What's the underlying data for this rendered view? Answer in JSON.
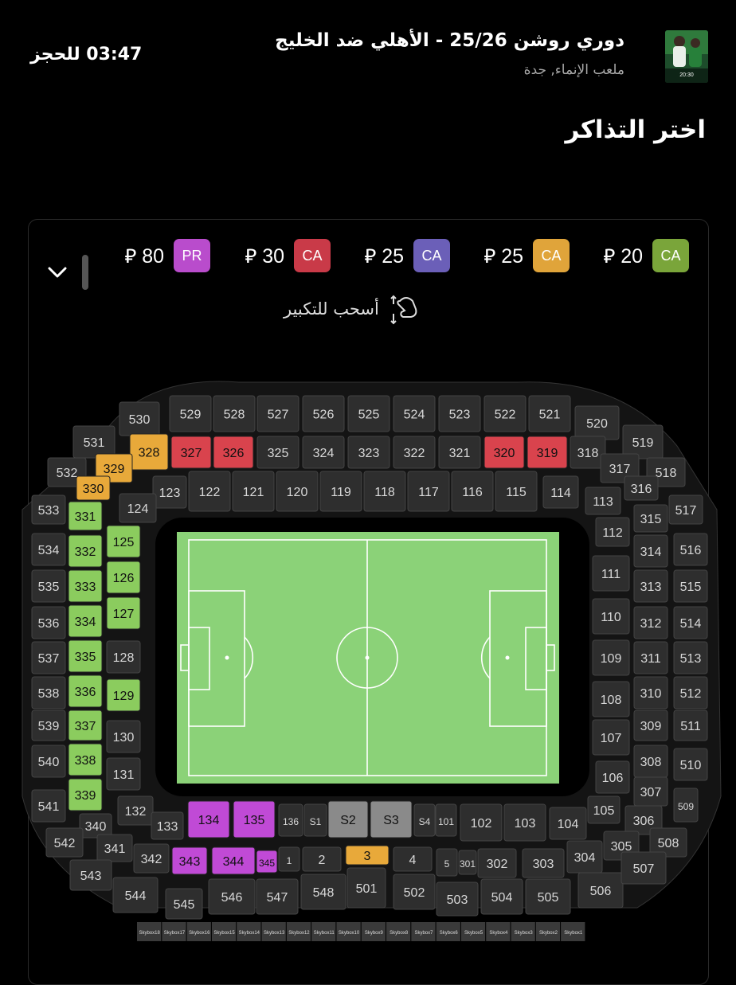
{
  "header": {
    "title": "دوري روشن 25/26 - الأهلي ضد الخليج",
    "venue": "ملعب الإنماء, جدة",
    "timer": "03:47 للحجز",
    "thumb_time": "20:30"
  },
  "page_title": "اختر التذاكر",
  "legend": [
    {
      "code": "CA",
      "price": "20 ⃁",
      "color": "#7aa53a"
    },
    {
      "code": "CA",
      "price": "25 ⃁",
      "color": "#e0a43a"
    },
    {
      "code": "CA",
      "price": "25 ⃁",
      "color": "#6b5fb8"
    },
    {
      "code": "CA",
      "price": "30 ⃁",
      "color": "#c93a48"
    },
    {
      "code": "PR",
      "price": "80 ⃁",
      "color": "#b94ccc"
    }
  ],
  "zoom_hint": "أسحب للتكبير",
  "colors": {
    "green": "#8bcc5e",
    "orange": "#e8a93a",
    "red": "#d9434d",
    "purple": "#c04ad6",
    "gray": "#2e2e2e",
    "pitch": "#8bd278"
  },
  "sections": {
    "s530": "530",
    "s529": "529",
    "s528": "528",
    "s527": "527",
    "s526": "526",
    "s525": "525",
    "s524": "524",
    "s523": "523",
    "s522": "522",
    "s521": "521",
    "s520": "520",
    "s531": "531",
    "s328": "328",
    "s327": "327",
    "s326": "326",
    "s325": "325",
    "s324": "324",
    "s323": "323",
    "s322": "322",
    "s321": "321",
    "s320": "320",
    "s319": "319",
    "s318": "318",
    "s519": "519",
    "s532": "532",
    "s329": "329",
    "s330": "330",
    "s317": "317",
    "s518": "518",
    "s316": "316",
    "s123": "123",
    "s122": "122",
    "s121": "121",
    "s120": "120",
    "s119": "119",
    "s118": "118",
    "s117": "117",
    "s116": "116",
    "s115": "115",
    "s114": "114",
    "s113": "113",
    "s533": "533",
    "s331": "331",
    "s124": "124",
    "s517": "517",
    "s315": "315",
    "s534": "534",
    "s332": "332",
    "s125": "125",
    "s112": "112",
    "s314": "314",
    "s516": "516",
    "s535": "535",
    "s333": "333",
    "s126": "126",
    "s111": "111",
    "s313": "313",
    "s515": "515",
    "s536": "536",
    "s334": "334",
    "s127": "127",
    "s110": "110",
    "s312": "312",
    "s514": "514",
    "s537": "537",
    "s335": "335",
    "s128": "128",
    "s109": "109",
    "s311": "311",
    "s513": "513",
    "s538": "538",
    "s336": "336",
    "s129": "129",
    "s108": "108",
    "s310": "310",
    "s512": "512",
    "s539": "539",
    "s337": "337",
    "s130": "130",
    "s107": "107",
    "s309": "309",
    "s511": "511",
    "s540": "540",
    "s338": "338",
    "s131": "131",
    "s106": "106",
    "s308": "308",
    "s510": "510",
    "s541": "541",
    "s339": "339",
    "s307": "307",
    "s509": "509",
    "s132": "132",
    "s340": "340",
    "s133": "133",
    "s134": "134",
    "s135": "135",
    "s136": "136",
    "sS1": "S1",
    "sS2": "S2",
    "sS3": "S3",
    "sS4": "S4",
    "s101": "101",
    "s102": "102",
    "s103": "103",
    "s104": "104",
    "s105": "105",
    "s306": "306",
    "s542": "542",
    "s341": "341",
    "s342": "342",
    "s343": "343",
    "s344": "344",
    "s345": "345",
    "g1": "1",
    "g2": "2",
    "g3": "3",
    "g4": "4",
    "g5": "5",
    "s301": "301",
    "s302": "302",
    "s303": "303",
    "s304": "304",
    "s305": "305",
    "s508": "508",
    "s543": "543",
    "s544": "544",
    "s545": "545",
    "s546": "546",
    "s547": "547",
    "s548": "548",
    "s501": "501",
    "s502": "502",
    "s503": "503",
    "s504": "504",
    "s505": "505",
    "s506": "506",
    "s507": "507"
  },
  "skyboxes": [
    "Skybox18",
    "Skybox17",
    "Skybox16",
    "Skybox15",
    "Skybox14",
    "Skybox13",
    "Skybox12",
    "Skybox11",
    "Skybox10",
    "Skybox9",
    "Skybox8",
    "Skybox7",
    "Skybox6",
    "Skybox5",
    "Skybox4",
    "Skybox3",
    "Skybox2",
    "Skybox1"
  ]
}
